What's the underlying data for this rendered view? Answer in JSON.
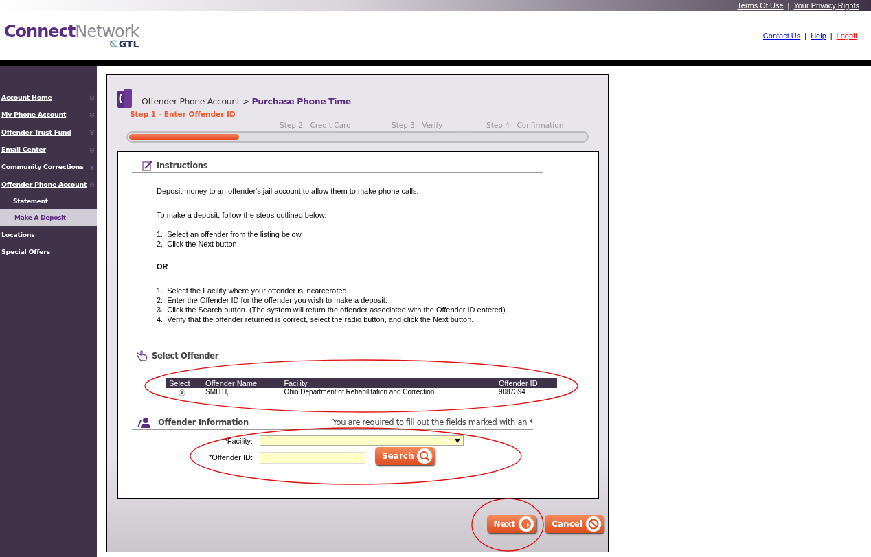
{
  "top_links": [
    "Terms Of Use",
    "Your Privacy Rights"
  ],
  "top_separator": "|",
  "logo": {
    "word_1": "Connect",
    "word_2": "Network",
    "sub": "GTL"
  },
  "header_links": [
    {
      "label": "Contact Us",
      "kind": "normal"
    },
    {
      "label": "Help",
      "kind": "normal"
    },
    {
      "label": "Logoff",
      "kind": "alert"
    }
  ],
  "header_separators": [
    "|",
    "|"
  ],
  "sidebar": {
    "items": [
      {
        "label": "Account Home",
        "expanded": false
      },
      {
        "label": "My Phone Account",
        "expanded": false
      },
      {
        "label": "Offender Trust Fund",
        "expanded": false
      },
      {
        "label": "Email Center",
        "expanded": false
      },
      {
        "label": "Community Corrections",
        "expanded": false
      },
      {
        "label": "Offender Phone Account",
        "expanded": true,
        "children": [
          {
            "label": "Statement",
            "selected": false
          },
          {
            "label": "Make A Deposit",
            "selected": true
          }
        ]
      },
      {
        "label": "Locations"
      },
      {
        "label": "Special Offers"
      }
    ]
  },
  "breadcrumb": {
    "parent": "Offender Phone Account",
    "separator": ">",
    "current": "Purchase Phone Time"
  },
  "steps": [
    {
      "label": "Step 1 - Enter Offender ID",
      "selected": true
    },
    {
      "label": "Step 2 - Credit Card",
      "selected": false
    },
    {
      "label": "Step 3 - Verify",
      "selected": false
    },
    {
      "label": "Step 4 - Confirmation",
      "selected": false
    }
  ],
  "progress": {
    "level": 0.24
  },
  "instructions": {
    "title": "Instructions",
    "intro": "Deposit money to an offender's jail account to allow them to make phone calls.",
    "lead": "To make a deposit, follow the steps outlined below:",
    "list_1": [
      {
        "number": "1.",
        "text": "Select an offender from the listing below."
      },
      {
        "number": "2.",
        "text": "Click the Next button"
      }
    ],
    "or": "OR",
    "list_2": [
      {
        "number": "1.",
        "text": "Select the Facility where your offender is incarcerated."
      },
      {
        "number": "2.",
        "text": "Enter the Offender ID for the offender you wish to make a deposit."
      },
      {
        "number": "3.",
        "text": "Click the Search button. (The system will return the offender associated with the Offender ID entered)"
      },
      {
        "number": "4.",
        "text": "Verify that the offender returned is correct, select the radio button, and click the Next button."
      }
    ]
  },
  "select_offender": {
    "title": "Select Offender",
    "columns": [
      "Select",
      "Offender Name",
      "Facility",
      "Offender ID"
    ],
    "rows": [
      {
        "selected": true,
        "name": "SMITH,",
        "facility": "Ohio Department of Rehabilitation and Correction",
        "offender_id": "9087394"
      }
    ]
  },
  "offender_information": {
    "title": "Offender Information",
    "note": "You are required to fill out the fields marked with an *",
    "facility_label": "*Facility:",
    "offender_id_label": "*Offender ID:",
    "search_button": "Search"
  },
  "buttons": [
    {
      "label": "Next",
      "kind": "next"
    },
    {
      "label": "Cancel",
      "kind": "cancel"
    }
  ]
}
